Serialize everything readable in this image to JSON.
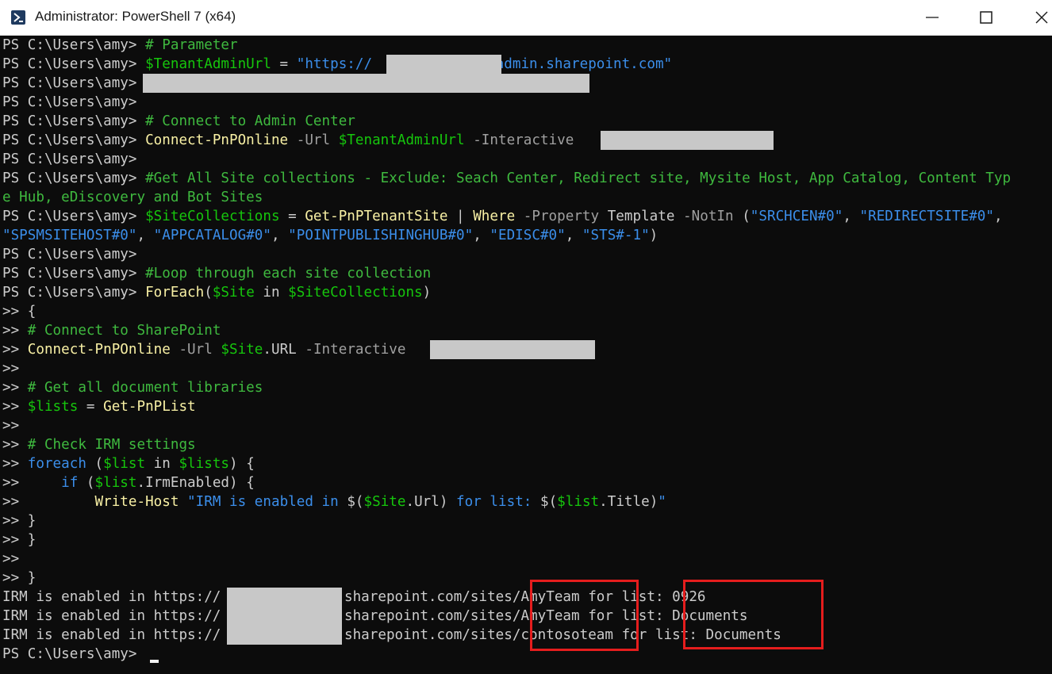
{
  "window": {
    "title": "Administrator: PowerShell 7 (x64)"
  },
  "prompt": "PS C:\\Users\\amy> ",
  "continuation": ">> ",
  "lines": {
    "l1": {
      "comment": "# Parameter"
    },
    "l2": {
      "var": "$TenantAdminUrl",
      "eq": " = ",
      "str_a": "\"https://",
      "str_b": "-admin.sharepoint.com\""
    },
    "l5": {
      "comment": "# Connect to Admin Center"
    },
    "l6": {
      "cmd": "Connect-PnPOnline",
      "p1": " -Url ",
      "var": "$TenantAdminUrl",
      "p2": " -Interactive "
    },
    "l8": {
      "comment": "#Get All Site collections - Exclude: Seach Center, Redirect site, Mysite Host, App Catalog, Content Typ",
      "wrap": "e Hub, eDiscovery and Bot Sites"
    },
    "l10": {
      "var": "$SiteCollections",
      "eq": " = ",
      "cmd": "Get-PnPTenantSite",
      "pipe": " | ",
      "cmd2": "Where",
      "p1": " -Property ",
      "plain": "Template",
      "p2": " -NotIn ",
      "paren": "(",
      "s1": "\"SRCHCEN#0\"",
      "comma": ", ",
      "s2": "\"REDIRECTSITE#0\"",
      "tail": ",",
      "wrap_s1": "\"SPSMSITEHOST#0\"",
      "wrap_s2": "\"APPCATALOG#0\"",
      "wrap_s3": "\"POINTPUBLISHINGHUB#0\"",
      "wrap_s4": "\"EDISC#0\"",
      "wrap_s5": "\"STS#-1\"",
      "wrap_end": ")"
    },
    "l13": {
      "comment": "#Loop through each site collection"
    },
    "l14": {
      "cmd": "ForEach",
      "open": "(",
      "var": "$Site",
      "kw": " in ",
      "var2": "$SiteCollections",
      "close": ")"
    },
    "l15": {
      "plain": "{"
    },
    "l16": {
      "comment": "# Connect to SharePoint"
    },
    "l17": {
      "cmd": "Connect-PnPOnline",
      "p1": " -Url ",
      "var": "$Site",
      "plain": ".URL",
      "p2": " -Interactive "
    },
    "l19": {
      "comment": "# Get all document libraries"
    },
    "l20": {
      "var": "$lists",
      "eq": " = ",
      "cmd": "Get-PnPList"
    },
    "l22": {
      "comment": "# Check IRM settings"
    },
    "l23": {
      "kw": "foreach",
      "open": " (",
      "var": "$list",
      "in": " in ",
      "var2": "$lists",
      "close": ") {"
    },
    "l24": {
      "indent": "    ",
      "kw": "if",
      "open": " (",
      "var": "$list",
      "plain": ".IrmEnabled",
      "close": ") {"
    },
    "l25": {
      "indent": "        ",
      "cmd": "Write-Host",
      "s_a": " \"IRM is enabled in ",
      "d1": "$(",
      "var": "$Site",
      "plain": ".Url",
      "c1": ")",
      "s_b": " for list: ",
      "d2": "$(",
      "var2": "$list",
      "plain2": ".Title",
      "c2": ")",
      "s_c": "\""
    },
    "l26": {
      "plain": "}"
    },
    "l27": {
      "plain": "}"
    },
    "l29": {
      "plain": "}"
    }
  },
  "output": [
    {
      "pre": "IRM is enabled in https://",
      "post": ".sharepoint.com/sites/",
      "site": "AmyTeam",
      "for": " for list: ",
      "list": "0926"
    },
    {
      "pre": "IRM is enabled in https://",
      "post": ".sharepoint.com/sites/",
      "site": "AmyTeam",
      "for": " for list: ",
      "list": "Documents"
    },
    {
      "pre": "IRM is enabled in https://",
      "post": ".sharepoint.com/sites/",
      "site": "contosoteam",
      "for": " for list: ",
      "list": "Documents"
    }
  ],
  "colors": {
    "background": "#0c0c0c",
    "comment": "#3fba3f",
    "variable": "#16c60c",
    "string": "#3b8eea",
    "command": "#f9f1a5",
    "highlight_box": "#e51d1d",
    "redaction": "#c8c8c8"
  }
}
